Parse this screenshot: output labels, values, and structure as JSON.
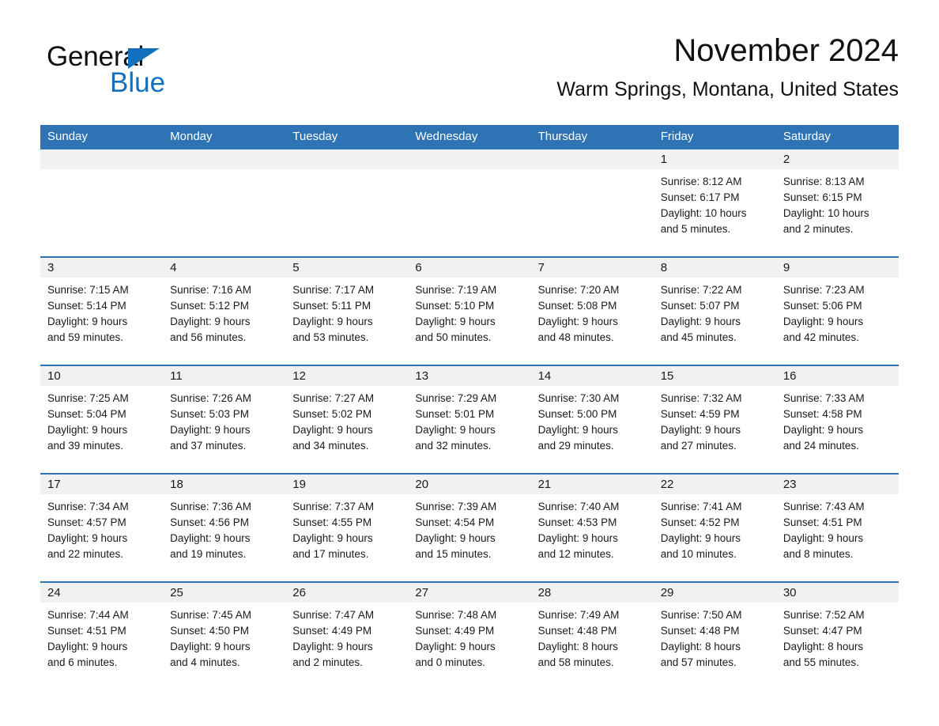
{
  "brand": {
    "name_part1": "General",
    "name_part2": "Blue",
    "triangle_color": "#1270bd",
    "logo_icon": "blue-triangle-icon"
  },
  "header": {
    "month_title": "November 2024",
    "location": "Warm Springs, Montana, United States"
  },
  "colors": {
    "header_blue": "#2e74b5",
    "date_band_gray": "#f1f1f1",
    "brand_blue": "#1270bd",
    "text": "#1a1a1a"
  },
  "weekdays": [
    "Sunday",
    "Monday",
    "Tuesday",
    "Wednesday",
    "Thursday",
    "Friday",
    "Saturday"
  ],
  "weeks": [
    [
      {
        "day": "",
        "sunrise": "",
        "sunset": "",
        "daylight_line1": "",
        "daylight_line2": ""
      },
      {
        "day": "",
        "sunrise": "",
        "sunset": "",
        "daylight_line1": "",
        "daylight_line2": ""
      },
      {
        "day": "",
        "sunrise": "",
        "sunset": "",
        "daylight_line1": "",
        "daylight_line2": ""
      },
      {
        "day": "",
        "sunrise": "",
        "sunset": "",
        "daylight_line1": "",
        "daylight_line2": ""
      },
      {
        "day": "",
        "sunrise": "",
        "sunset": "",
        "daylight_line1": "",
        "daylight_line2": ""
      },
      {
        "day": "1",
        "sunrise": "Sunrise: 8:12 AM",
        "sunset": "Sunset: 6:17 PM",
        "daylight_line1": "Daylight: 10 hours",
        "daylight_line2": "and 5 minutes."
      },
      {
        "day": "2",
        "sunrise": "Sunrise: 8:13 AM",
        "sunset": "Sunset: 6:15 PM",
        "daylight_line1": "Daylight: 10 hours",
        "daylight_line2": "and 2 minutes."
      }
    ],
    [
      {
        "day": "3",
        "sunrise": "Sunrise: 7:15 AM",
        "sunset": "Sunset: 5:14 PM",
        "daylight_line1": "Daylight: 9 hours",
        "daylight_line2": "and 59 minutes."
      },
      {
        "day": "4",
        "sunrise": "Sunrise: 7:16 AM",
        "sunset": "Sunset: 5:12 PM",
        "daylight_line1": "Daylight: 9 hours",
        "daylight_line2": "and 56 minutes."
      },
      {
        "day": "5",
        "sunrise": "Sunrise: 7:17 AM",
        "sunset": "Sunset: 5:11 PM",
        "daylight_line1": "Daylight: 9 hours",
        "daylight_line2": "and 53 minutes."
      },
      {
        "day": "6",
        "sunrise": "Sunrise: 7:19 AM",
        "sunset": "Sunset: 5:10 PM",
        "daylight_line1": "Daylight: 9 hours",
        "daylight_line2": "and 50 minutes."
      },
      {
        "day": "7",
        "sunrise": "Sunrise: 7:20 AM",
        "sunset": "Sunset: 5:08 PM",
        "daylight_line1": "Daylight: 9 hours",
        "daylight_line2": "and 48 minutes."
      },
      {
        "day": "8",
        "sunrise": "Sunrise: 7:22 AM",
        "sunset": "Sunset: 5:07 PM",
        "daylight_line1": "Daylight: 9 hours",
        "daylight_line2": "and 45 minutes."
      },
      {
        "day": "9",
        "sunrise": "Sunrise: 7:23 AM",
        "sunset": "Sunset: 5:06 PM",
        "daylight_line1": "Daylight: 9 hours",
        "daylight_line2": "and 42 minutes."
      }
    ],
    [
      {
        "day": "10",
        "sunrise": "Sunrise: 7:25 AM",
        "sunset": "Sunset: 5:04 PM",
        "daylight_line1": "Daylight: 9 hours",
        "daylight_line2": "and 39 minutes."
      },
      {
        "day": "11",
        "sunrise": "Sunrise: 7:26 AM",
        "sunset": "Sunset: 5:03 PM",
        "daylight_line1": "Daylight: 9 hours",
        "daylight_line2": "and 37 minutes."
      },
      {
        "day": "12",
        "sunrise": "Sunrise: 7:27 AM",
        "sunset": "Sunset: 5:02 PM",
        "daylight_line1": "Daylight: 9 hours",
        "daylight_line2": "and 34 minutes."
      },
      {
        "day": "13",
        "sunrise": "Sunrise: 7:29 AM",
        "sunset": "Sunset: 5:01 PM",
        "daylight_line1": "Daylight: 9 hours",
        "daylight_line2": "and 32 minutes."
      },
      {
        "day": "14",
        "sunrise": "Sunrise: 7:30 AM",
        "sunset": "Sunset: 5:00 PM",
        "daylight_line1": "Daylight: 9 hours",
        "daylight_line2": "and 29 minutes."
      },
      {
        "day": "15",
        "sunrise": "Sunrise: 7:32 AM",
        "sunset": "Sunset: 4:59 PM",
        "daylight_line1": "Daylight: 9 hours",
        "daylight_line2": "and 27 minutes."
      },
      {
        "day": "16",
        "sunrise": "Sunrise: 7:33 AM",
        "sunset": "Sunset: 4:58 PM",
        "daylight_line1": "Daylight: 9 hours",
        "daylight_line2": "and 24 minutes."
      }
    ],
    [
      {
        "day": "17",
        "sunrise": "Sunrise: 7:34 AM",
        "sunset": "Sunset: 4:57 PM",
        "daylight_line1": "Daylight: 9 hours",
        "daylight_line2": "and 22 minutes."
      },
      {
        "day": "18",
        "sunrise": "Sunrise: 7:36 AM",
        "sunset": "Sunset: 4:56 PM",
        "daylight_line1": "Daylight: 9 hours",
        "daylight_line2": "and 19 minutes."
      },
      {
        "day": "19",
        "sunrise": "Sunrise: 7:37 AM",
        "sunset": "Sunset: 4:55 PM",
        "daylight_line1": "Daylight: 9 hours",
        "daylight_line2": "and 17 minutes."
      },
      {
        "day": "20",
        "sunrise": "Sunrise: 7:39 AM",
        "sunset": "Sunset: 4:54 PM",
        "daylight_line1": "Daylight: 9 hours",
        "daylight_line2": "and 15 minutes."
      },
      {
        "day": "21",
        "sunrise": "Sunrise: 7:40 AM",
        "sunset": "Sunset: 4:53 PM",
        "daylight_line1": "Daylight: 9 hours",
        "daylight_line2": "and 12 minutes."
      },
      {
        "day": "22",
        "sunrise": "Sunrise: 7:41 AM",
        "sunset": "Sunset: 4:52 PM",
        "daylight_line1": "Daylight: 9 hours",
        "daylight_line2": "and 10 minutes."
      },
      {
        "day": "23",
        "sunrise": "Sunrise: 7:43 AM",
        "sunset": "Sunset: 4:51 PM",
        "daylight_line1": "Daylight: 9 hours",
        "daylight_line2": "and 8 minutes."
      }
    ],
    [
      {
        "day": "24",
        "sunrise": "Sunrise: 7:44 AM",
        "sunset": "Sunset: 4:51 PM",
        "daylight_line1": "Daylight: 9 hours",
        "daylight_line2": "and 6 minutes."
      },
      {
        "day": "25",
        "sunrise": "Sunrise: 7:45 AM",
        "sunset": "Sunset: 4:50 PM",
        "daylight_line1": "Daylight: 9 hours",
        "daylight_line2": "and 4 minutes."
      },
      {
        "day": "26",
        "sunrise": "Sunrise: 7:47 AM",
        "sunset": "Sunset: 4:49 PM",
        "daylight_line1": "Daylight: 9 hours",
        "daylight_line2": "and 2 minutes."
      },
      {
        "day": "27",
        "sunrise": "Sunrise: 7:48 AM",
        "sunset": "Sunset: 4:49 PM",
        "daylight_line1": "Daylight: 9 hours",
        "daylight_line2": "and 0 minutes."
      },
      {
        "day": "28",
        "sunrise": "Sunrise: 7:49 AM",
        "sunset": "Sunset: 4:48 PM",
        "daylight_line1": "Daylight: 8 hours",
        "daylight_line2": "and 58 minutes."
      },
      {
        "day": "29",
        "sunrise": "Sunrise: 7:50 AM",
        "sunset": "Sunset: 4:48 PM",
        "daylight_line1": "Daylight: 8 hours",
        "daylight_line2": "and 57 minutes."
      },
      {
        "day": "30",
        "sunrise": "Sunrise: 7:52 AM",
        "sunset": "Sunset: 4:47 PM",
        "daylight_line1": "Daylight: 8 hours",
        "daylight_line2": "and 55 minutes."
      }
    ]
  ]
}
